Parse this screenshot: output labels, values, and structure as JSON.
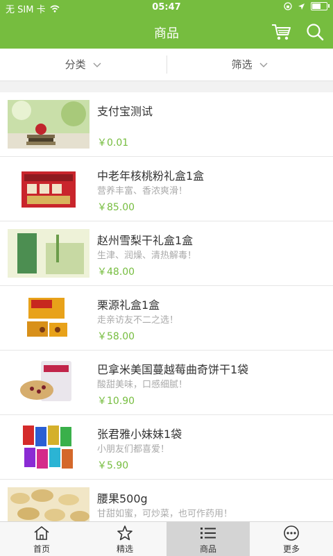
{
  "status": {
    "carrier": "无 SIM 卡",
    "time": "05:47"
  },
  "header": {
    "title": "商品",
    "icons": [
      "cart-icon",
      "search-icon"
    ]
  },
  "filters": {
    "category_label": "分类",
    "filter_label": "筛选"
  },
  "products": [
    {
      "name": "支付宝测试",
      "desc": "",
      "price": "￥0.01"
    },
    {
      "name": "中老年核桃粉礼盒1盒",
      "desc": "营养丰富、香浓爽滑！",
      "price": "￥85.00"
    },
    {
      "name": "赵州雪梨干礼盒1盒",
      "desc": "生津、润燥、清热解毒！",
      "price": "￥48.00"
    },
    {
      "name": "栗源礼盒1盒",
      "desc": "走亲访友不二之选！",
      "price": "￥58.00"
    },
    {
      "name": "巴拿米美国蔓越莓曲奇饼干1袋",
      "desc": "酸甜美味，口感细腻！",
      "price": "￥10.90"
    },
    {
      "name": "张君雅小妹妹1袋",
      "desc": "小朋友们都喜爱！",
      "price": "￥5.90"
    },
    {
      "name": "腰果500g",
      "desc": "甘甜如蜜，可炒菜，也可作药用！",
      "price": ""
    }
  ],
  "tabs": [
    {
      "label": "首页",
      "icon": "home-icon"
    },
    {
      "label": "精选",
      "icon": "star-icon"
    },
    {
      "label": "商品",
      "icon": "list-icon"
    },
    {
      "label": "更多",
      "icon": "more-icon"
    }
  ],
  "colors": {
    "accent": "#76bd3f",
    "price": "#76bd3f",
    "active_tab_bg": "#d4d4d4"
  }
}
